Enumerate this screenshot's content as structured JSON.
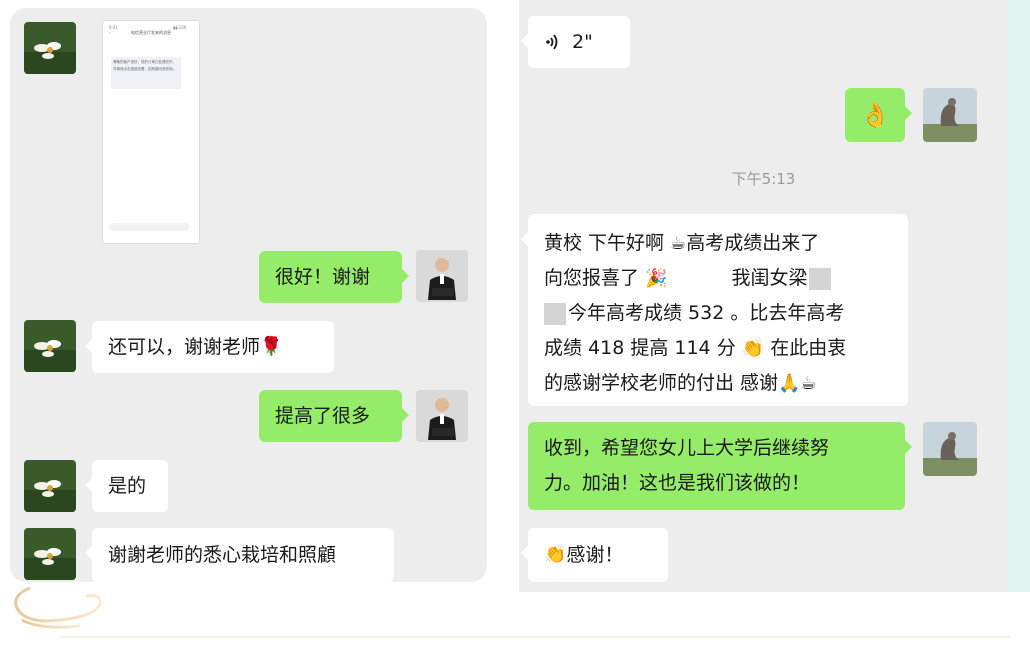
{
  "left_chat": {
    "messages": [
      {
        "side": "in",
        "kind": "screenshot",
        "inner_title": "电信营业厅发来的消息",
        "inner_text": "尊敬的客户您好，您的订单已处理完毕，详情请点击链接查看，如有疑问请咨询。"
      },
      {
        "side": "out",
        "text": "很好！谢谢"
      },
      {
        "side": "in",
        "text": "还可以，谢谢老师",
        "emoji": "🌹"
      },
      {
        "side": "out",
        "text": "提高了很多"
      },
      {
        "side": "in",
        "text": "是的"
      },
      {
        "side": "in",
        "text": "谢謝老师的悉心栽培和照顧"
      }
    ]
  },
  "right_chat": {
    "voice": {
      "icon": "voice-icon",
      "duration": "2\""
    },
    "ok_emoji": "👌",
    "timestamp": "下午5:13",
    "long_message": {
      "line1_a": "黄校 下午好啊 ",
      "line1_b": "高考成绩出来了",
      "line2_a": "向您报喜了 ",
      "line2_b": "我闺女梁",
      "line3": "今年高考成绩 532 。比去年高考",
      "line4_a": "成绩 418 提高 114 分 ",
      "line4_b": " 在此由衷",
      "line5": "的感谢学校老师的付出 感谢",
      "emoji_coffee": "☕",
      "emoji_party": "🎉",
      "emoji_clap": "👏",
      "emoji_pray": "🙏"
    },
    "reply_line1": "收到，希望您女儿上大学后继续努",
    "reply_line2": "力。加油！这也是我们该做的！",
    "thanks_text": "感谢！",
    "thanks_emoji": "👏"
  },
  "colors": {
    "chat_background": "#ededed",
    "incoming_bubble": "#ffffff",
    "outgoing_bubble": "#95ec69",
    "timestamp_text": "#999999",
    "decoration_gold": "#e8c89a"
  }
}
